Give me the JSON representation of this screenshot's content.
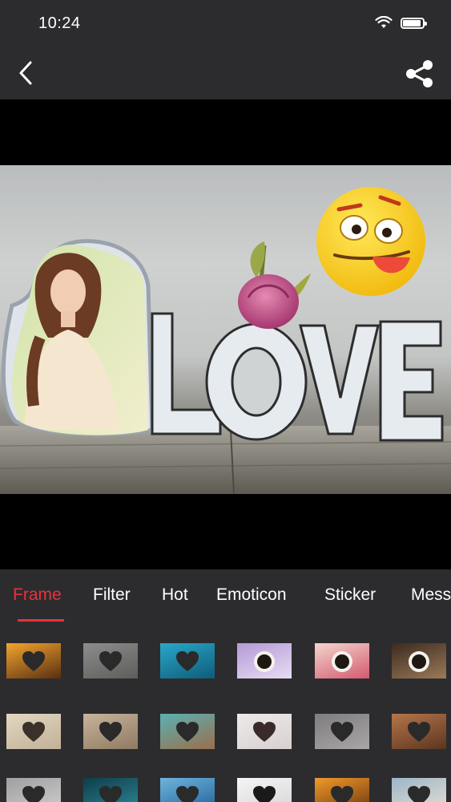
{
  "status": {
    "time": "10:24"
  },
  "nav": {
    "back_icon": "chevron-left-icon",
    "share_icon": "share-icon"
  },
  "tabs": [
    {
      "label": "Frame",
      "active": true
    },
    {
      "label": "Filter",
      "active": false
    },
    {
      "label": "Hot",
      "active": false
    },
    {
      "label": "Emoticon",
      "active": false
    },
    {
      "label": "Sticker",
      "active": false
    },
    {
      "label": "Mess",
      "active": false
    }
  ],
  "colors": {
    "accent": "#e8323a",
    "bar": "#2c2c2e",
    "canvas": "#000000"
  },
  "thumbnails": [
    [
      {
        "theme": "sunset-book-heart"
      },
      {
        "theme": "grey-heart-flower"
      },
      {
        "theme": "blue-hands-heart"
      },
      {
        "theme": "purple-coffee-cup"
      },
      {
        "theme": "pink-hearts-cup"
      },
      {
        "theme": "dark-coffee-cup"
      }
    ],
    [
      {
        "theme": "cream-heart"
      },
      {
        "theme": "wood-heart"
      },
      {
        "theme": "teal-heart"
      },
      {
        "theme": "white-string-heart"
      },
      {
        "theme": "grey-text-heart"
      },
      {
        "theme": "brown-heart"
      }
    ],
    [
      {
        "theme": "grey-heart-frame"
      },
      {
        "theme": "dark-teal-heart"
      },
      {
        "theme": "blue-water-heart"
      },
      {
        "theme": "white-heart"
      },
      {
        "theme": "orange-book-heart"
      },
      {
        "theme": "blue-book-heart"
      }
    ]
  ]
}
